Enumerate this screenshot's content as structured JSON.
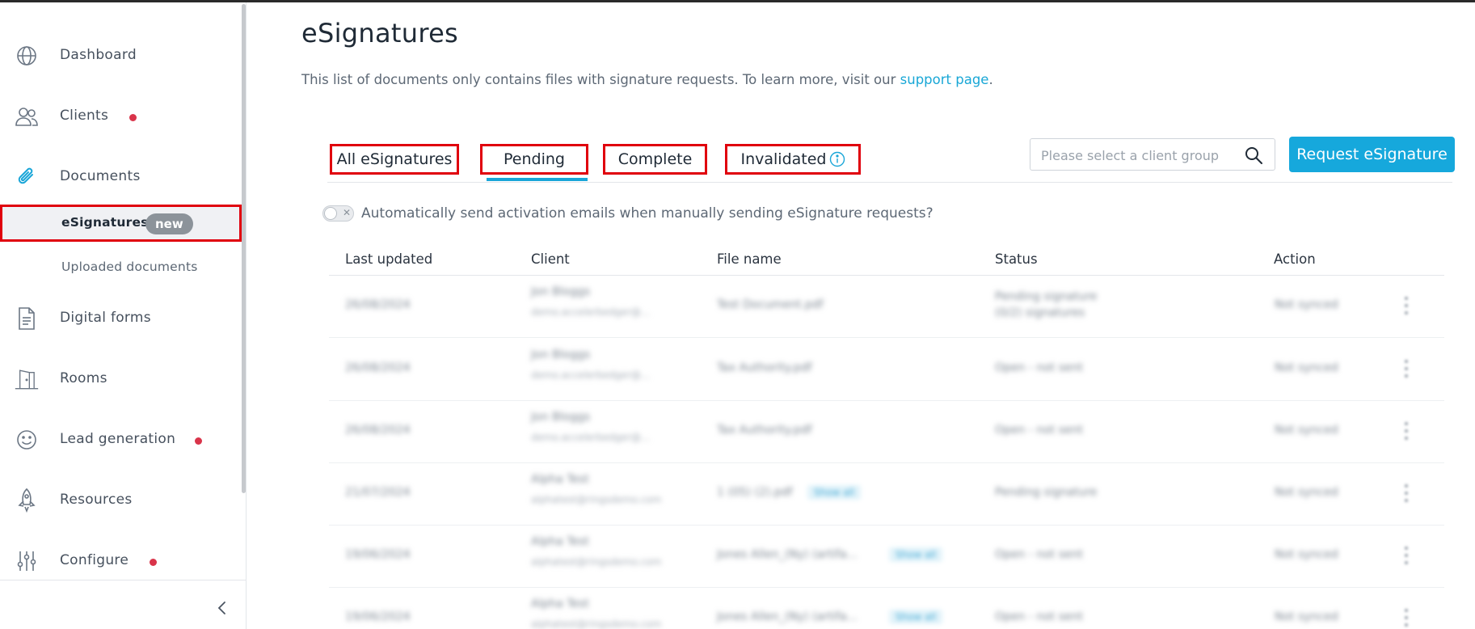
{
  "sidebar": {
    "items": [
      {
        "label": "Dashboard",
        "icon": "globe-icon",
        "dot": false
      },
      {
        "label": "Clients",
        "icon": "users-icon",
        "dot": true
      },
      {
        "label": "Documents",
        "icon": "paperclip-icon",
        "dot": false
      },
      {
        "label": "Digital forms",
        "icon": "document-icon",
        "dot": false
      },
      {
        "label": "Rooms",
        "icon": "door-icon",
        "dot": false
      },
      {
        "label": "Lead generation",
        "icon": "smiley-icon",
        "dot": true
      },
      {
        "label": "Resources",
        "icon": "rocket-icon",
        "dot": false
      },
      {
        "label": "Configure",
        "icon": "sliders-icon",
        "dot": true
      }
    ],
    "sub_items": [
      {
        "label": "eSignatures",
        "badge": "new",
        "active": true
      },
      {
        "label": "Uploaded documents",
        "active": false
      }
    ],
    "collapse_icon": "chevron-left-icon",
    "notification_color": "#d9344a"
  },
  "main": {
    "title": "eSignatures",
    "intro": "This list of documents only contains files with signature requests. To learn more, visit our",
    "intro_link": "support page",
    "intro_end": ".",
    "tabs": [
      {
        "label": "All eSignatures",
        "selected": false
      },
      {
        "label": "Pending",
        "selected": true
      },
      {
        "label": "Complete",
        "selected": false
      },
      {
        "label": "Invalidated",
        "selected": false,
        "icon": "info-icon"
      }
    ],
    "search": {
      "placeholder": "Please select a client group",
      "value": ""
    },
    "request_button": "Request eSignature",
    "accent_color": "#16a8dc",
    "toggle_label": "Automatically send activation emails when manually sending eSignature requests?",
    "toggle_on": false,
    "columns": [
      "Last updated",
      "Client",
      "File name",
      "Status",
      "Action"
    ],
    "rows": [
      {
        "date": "26/08/2024",
        "client": "Jon Bloggs",
        "email": "demo.accelerbedger@...",
        "file": "Test Document.pdf",
        "chip": "",
        "status": "Pending signature",
        "status2": "(0/2) signatures",
        "action": "Not synced"
      },
      {
        "date": "26/08/2024",
        "client": "Jon Bloggs",
        "email": "demo.accelerbedger@...",
        "file": "Tax Authority.pdf",
        "chip": "",
        "status": "Open - not sent",
        "status2": "",
        "action": "Not synced"
      },
      {
        "date": "26/08/2024",
        "client": "Jon Bloggs",
        "email": "demo.accelerbedger@...",
        "file": "Tax Authority.pdf",
        "chip": "",
        "status": "Open - not sent",
        "status2": "",
        "action": "Not synced"
      },
      {
        "date": "21/07/2024",
        "client": "Alpha Test",
        "email": "alphatest@ringsdemo.com",
        "file": "1 (05) (2).pdf",
        "chip": "Show all",
        "status": "Pending signature",
        "status2": "",
        "action": "Not synced"
      },
      {
        "date": "19/06/2024",
        "client": "Alpha Test",
        "email": "alphatest@ringsdemo.com",
        "file": "Jones Allen_(Ny) (artifa...",
        "chip": "Show all",
        "status": "Open - not sent",
        "status2": "",
        "action": "Not synced"
      },
      {
        "date": "19/06/2024",
        "client": "Alpha Test",
        "email": "alphatest@ringsdemo.com",
        "file": "Jones Allen_(Ny) (artifa...",
        "chip": "Show all",
        "status": "Open - not sent",
        "status2": "",
        "action": "Not synced"
      }
    ]
  }
}
